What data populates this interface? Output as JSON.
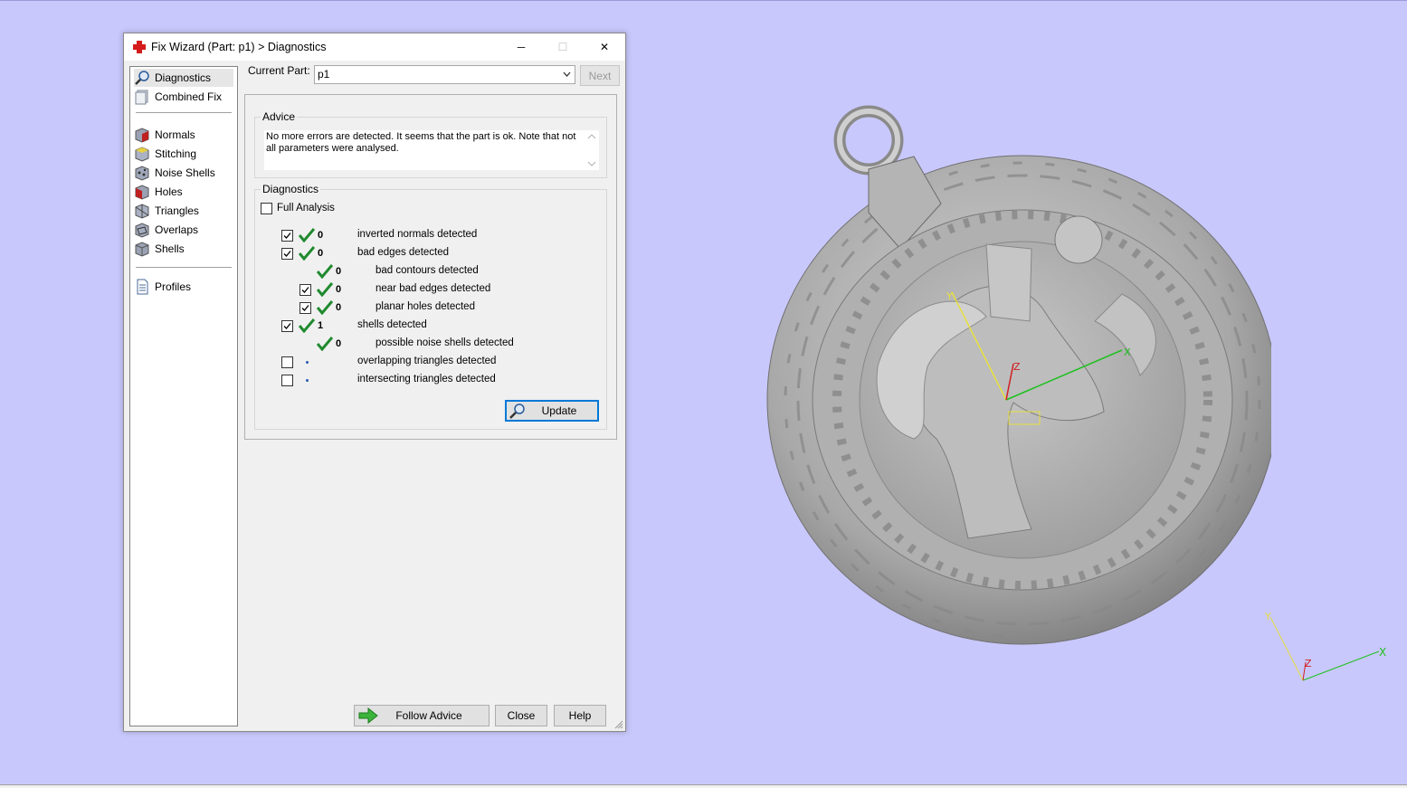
{
  "window": {
    "title": "Fix Wizard (Part: p1) > Diagnostics",
    "minimize_glyph": "─",
    "maximize_glyph": "☐",
    "close_glyph": "✕"
  },
  "sidebar": {
    "items": [
      {
        "label": "Diagnostics",
        "icon": "magnifier-icon"
      },
      {
        "label": "Combined Fix",
        "icon": "combined-fix-icon"
      },
      {
        "label": "Normals",
        "icon": "normals-cube-icon"
      },
      {
        "label": "Stitching",
        "icon": "stitching-cube-icon"
      },
      {
        "label": "Noise Shells",
        "icon": "noise-shells-cube-icon"
      },
      {
        "label": "Holes",
        "icon": "holes-cube-icon"
      },
      {
        "label": "Triangles",
        "icon": "triangles-cube-icon"
      },
      {
        "label": "Overlaps",
        "icon": "overlaps-cube-icon"
      },
      {
        "label": "Shells",
        "icon": "shells-cube-icon"
      },
      {
        "label": "Profiles",
        "icon": "profiles-document-icon"
      }
    ]
  },
  "current_part": {
    "label": "Current Part:",
    "value": "p1",
    "next_label": "Next"
  },
  "advice": {
    "title": "Advice",
    "text": "No more errors are detected. It seems that the part is ok. Note that not all parameters were analysed."
  },
  "diagnostics": {
    "title": "Diagnostics",
    "full_analysis_label": "Full Analysis",
    "full_analysis_checked": false,
    "rows": [
      {
        "count": "0",
        "label": "inverted normals detected",
        "checked": true,
        "status": "ok"
      },
      {
        "count": "0",
        "label": "bad edges detected",
        "checked": true,
        "status": "ok"
      },
      {
        "count": "0",
        "label": "bad contours detected",
        "checked": null,
        "status": "ok"
      },
      {
        "count": "0",
        "label": "near bad edges detected",
        "checked": true,
        "status": "ok"
      },
      {
        "count": "0",
        "label": "planar holes detected",
        "checked": true,
        "status": "ok"
      },
      {
        "count": "1",
        "label": "shells detected",
        "checked": true,
        "status": "ok"
      },
      {
        "count": "0",
        "label": "possible noise shells detected",
        "checked": null,
        "status": "ok"
      },
      {
        "count": "",
        "label": "overlapping triangles detected",
        "checked": false,
        "status": "not-analysed"
      },
      {
        "count": "",
        "label": "intersecting triangles detected",
        "checked": false,
        "status": "not-analysed"
      }
    ],
    "update_label": "Update"
  },
  "footer": {
    "follow_advice_label": "Follow Advice",
    "close_label": "Close",
    "help_label": "Help"
  },
  "viewport": {
    "background": "#c8c8fc",
    "model": "ram-head-pendant",
    "gizmo_axes": {
      "x": "X",
      "y": "Y",
      "z": "Z"
    },
    "corner_axes": {
      "x": "X",
      "y": "Y",
      "z": "Z"
    },
    "colors": {
      "x_axis": "#20c020",
      "y_axis": "#e8e040",
      "z_axis": "#d02020"
    }
  },
  "colors": {
    "check_green": "#1f8a2e",
    "focus_blue": "#0078d7",
    "title_icon_red": "#d41a1a"
  }
}
